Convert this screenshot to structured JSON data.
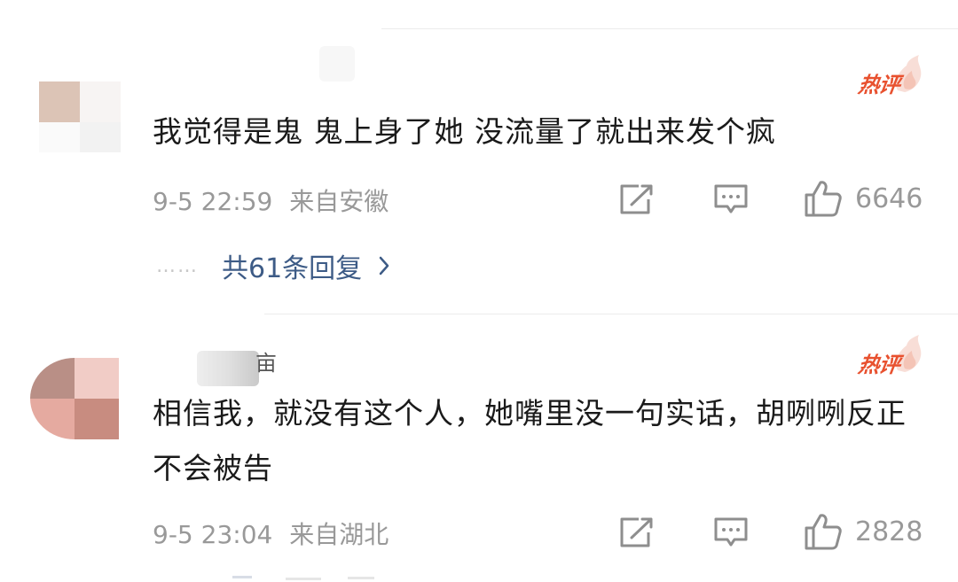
{
  "comments": [
    {
      "badge": "热评",
      "text": "我觉得是鬼  鬼上身了她 没流量了就出来发个疯",
      "time": "9-5 22:59",
      "location": "来自安徽",
      "likes": "6646",
      "replies_link": "共61条回复",
      "replies_dots": "……",
      "icons": [
        "repost-icon",
        "comment-icon",
        "thumbs-up-icon"
      ]
    },
    {
      "badge": "热评",
      "name_fragment": "亩",
      "text": "相信我，就没有这个人，她嘴里没一句实话，胡咧咧反正不会被告",
      "time": "9-5 23:04",
      "location": "来自湖北",
      "likes": "2828",
      "icons": [
        "repost-icon",
        "comment-icon",
        "thumbs-up-icon"
      ]
    }
  ],
  "colors": {
    "text": "#1a1a1a",
    "meta": "#999999",
    "link": "#3d5b86",
    "badge": "#e8512f"
  }
}
